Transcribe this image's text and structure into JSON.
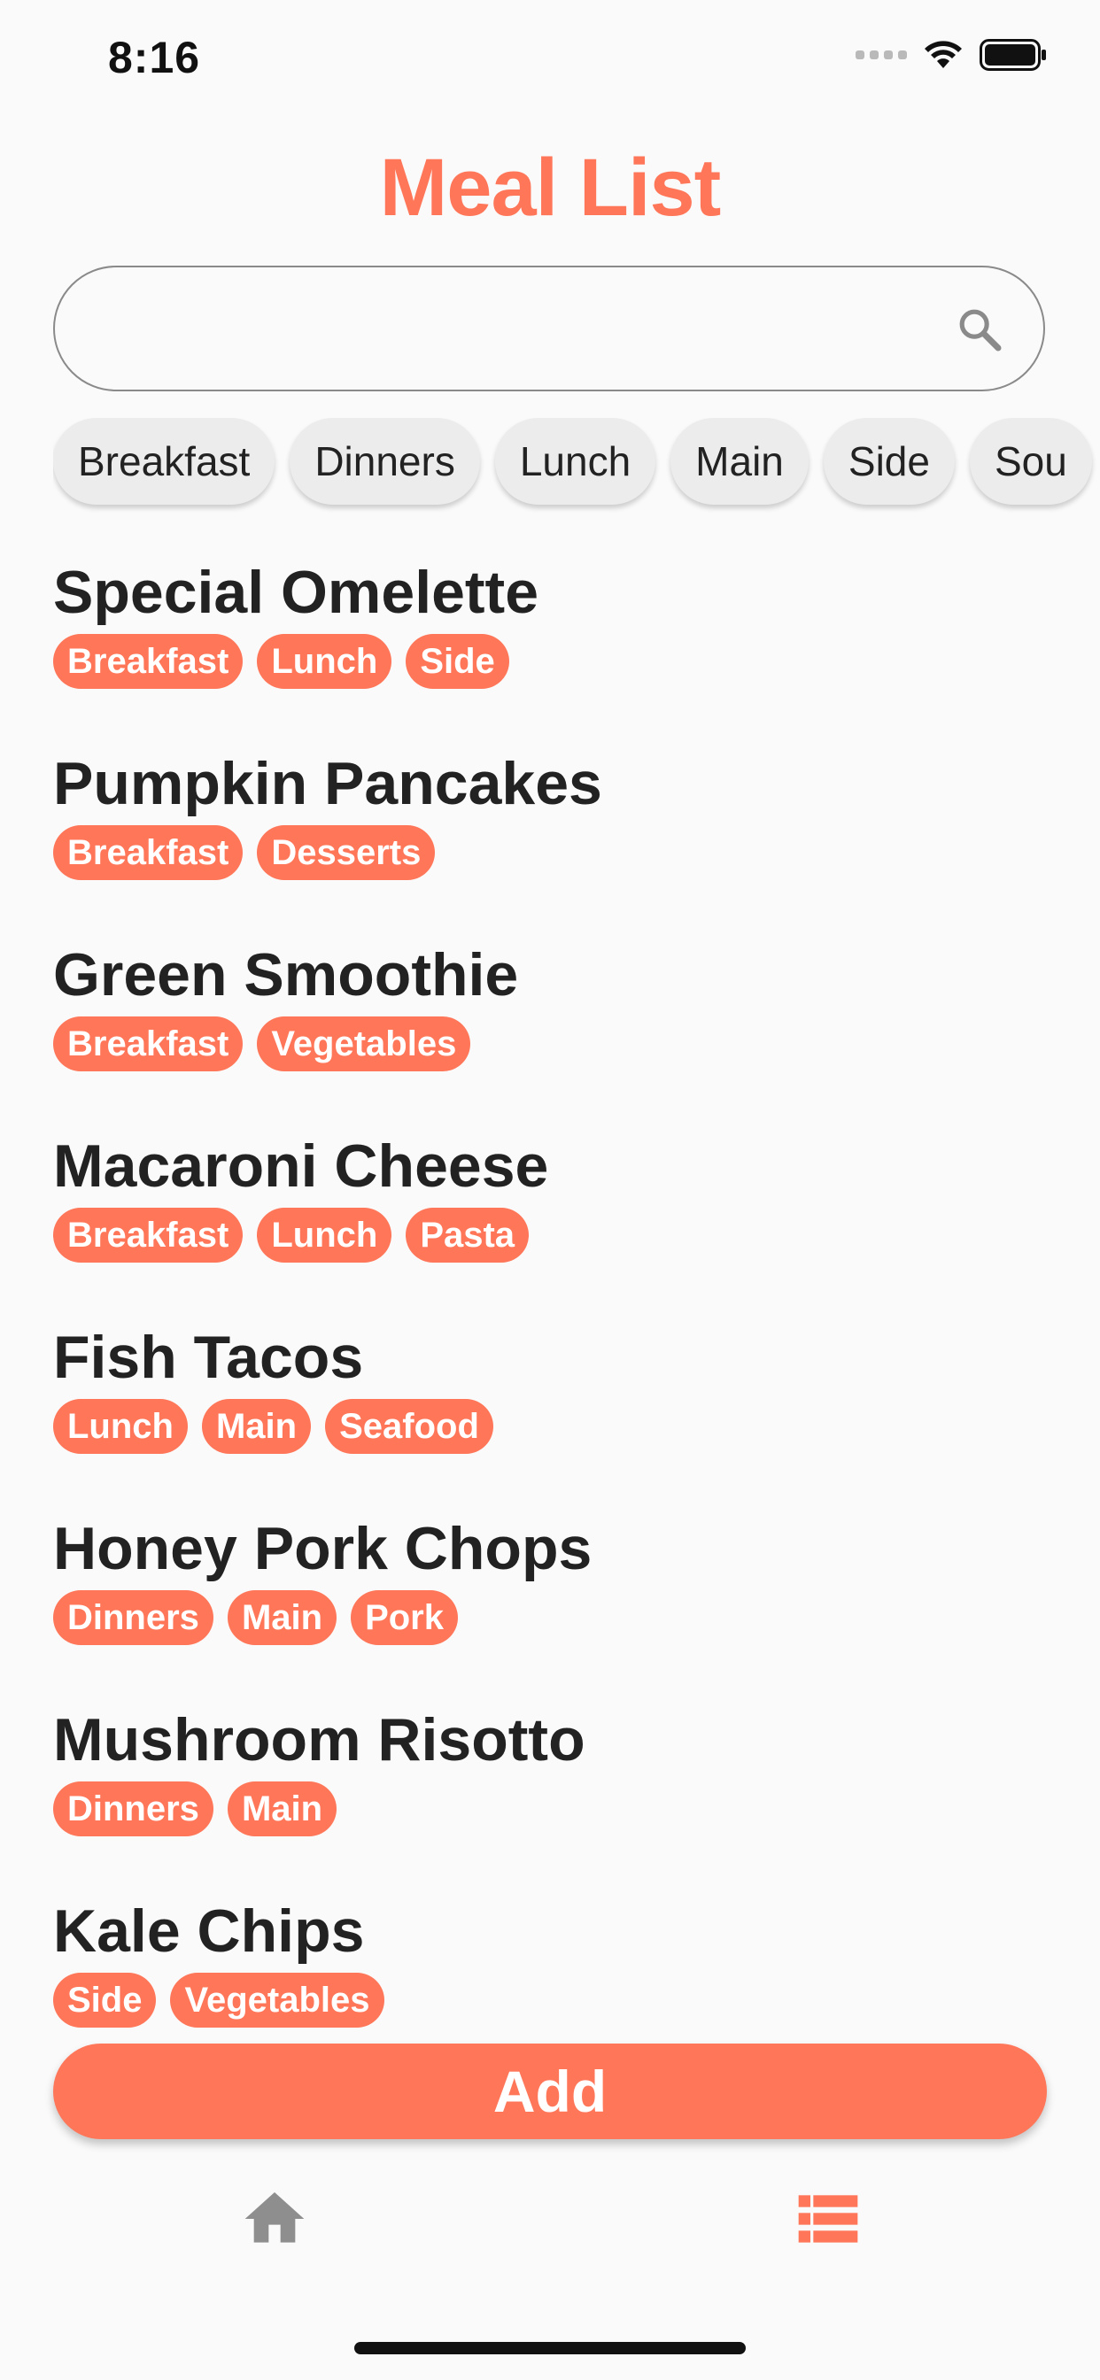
{
  "status_bar": {
    "time": "8:16"
  },
  "header": {
    "title": "Meal List"
  },
  "search": {
    "value": "",
    "placeholder": ""
  },
  "filters": [
    "Breakfast",
    "Dinners",
    "Lunch",
    "Main",
    "Side",
    "Sou"
  ],
  "meals": [
    {
      "name": "Special Omelette",
      "tags": [
        "Breakfast",
        "Lunch",
        "Side"
      ]
    },
    {
      "name": "Pumpkin Pancakes",
      "tags": [
        "Breakfast",
        "Desserts"
      ]
    },
    {
      "name": "Green Smoothie",
      "tags": [
        "Breakfast",
        "Vegetables"
      ]
    },
    {
      "name": "Macaroni Cheese",
      "tags": [
        "Breakfast",
        "Lunch",
        "Pasta"
      ]
    },
    {
      "name": "Fish Tacos",
      "tags": [
        "Lunch",
        "Main",
        "Seafood"
      ]
    },
    {
      "name": "Honey Pork Chops",
      "tags": [
        "Dinners",
        "Main",
        "Pork"
      ]
    },
    {
      "name": "Mushroom Risotto",
      "tags": [
        "Dinners",
        "Main"
      ]
    },
    {
      "name": "Kale Chips",
      "tags": [
        "Side",
        "Vegetables"
      ]
    }
  ],
  "actions": {
    "add_label": "Add"
  },
  "nav": {
    "items": [
      {
        "icon": "home-icon",
        "active": false
      },
      {
        "icon": "list-icon",
        "active": true
      }
    ]
  },
  "colors": {
    "accent": "#ff7659",
    "chip_bg": "#ececec",
    "text": "#222222",
    "nav_inactive": "#8e8e8e"
  }
}
